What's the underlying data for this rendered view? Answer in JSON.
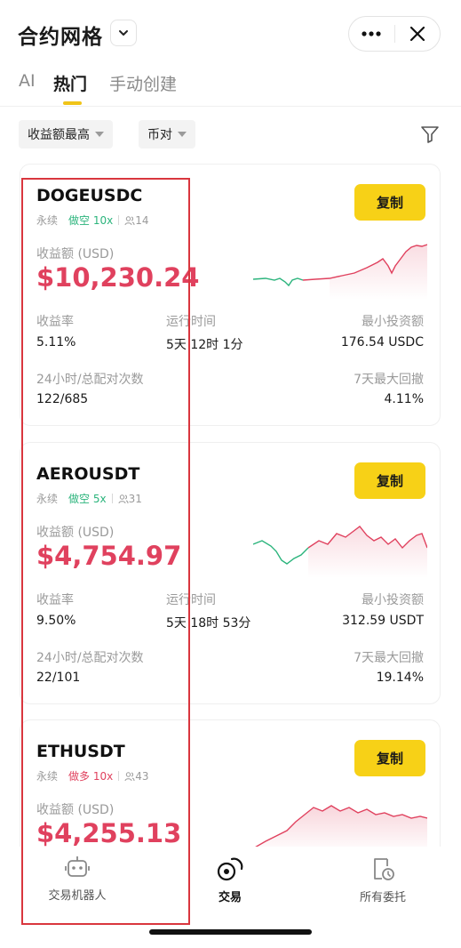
{
  "header": {
    "title": "合约网格"
  },
  "tabs": [
    {
      "label": "AI"
    },
    {
      "label": "热门"
    },
    {
      "label": "手动创建"
    }
  ],
  "filters": {
    "sort": "收益额最高",
    "pair": "币对"
  },
  "cards": [
    {
      "symbol": "DOGEUSDC",
      "type": "永续",
      "direction": "做空 10x",
      "followers": "14",
      "copy": "复制",
      "pnl_label": "收益额 (USD)",
      "pnl_value": "$10,230.24",
      "roi_label": "收益率",
      "roi": "5.11%",
      "runtime_label": "运行时间",
      "runtime": "5天 12时 1分",
      "min_label": "最小投资额",
      "min": "176.54 USDC",
      "match_label": "24小时/总配对次数",
      "match": "122/685",
      "dd_label": "7天最大回撤",
      "dd": "4.11%"
    },
    {
      "symbol": "AEROUSDT",
      "type": "永续",
      "direction": "做空 5x",
      "followers": "31",
      "copy": "复制",
      "pnl_label": "收益额 (USD)",
      "pnl_value": "$4,754.97",
      "roi_label": "收益率",
      "roi": "9.50%",
      "runtime_label": "运行时间",
      "runtime": "5天 18时 53分",
      "min_label": "最小投资额",
      "min": "312.59 USDT",
      "match_label": "24小时/总配对次数",
      "match": "22/101",
      "dd_label": "7天最大回撤",
      "dd": "19.14%"
    },
    {
      "symbol": "ETHUSDT",
      "type": "永续",
      "direction": "做多 10x",
      "followers": "43",
      "copy": "复制",
      "pnl_label": "收益额 (USD)",
      "pnl_value": "$4,255.13"
    }
  ],
  "nav": [
    {
      "label": "交易机器人"
    },
    {
      "label": "交易"
    },
    {
      "label": "所有委托"
    }
  ],
  "colors": {
    "accent": "#f7d117",
    "profit": "#e0415e",
    "loss": "#2bb47c",
    "highlight": "#d9363e"
  }
}
